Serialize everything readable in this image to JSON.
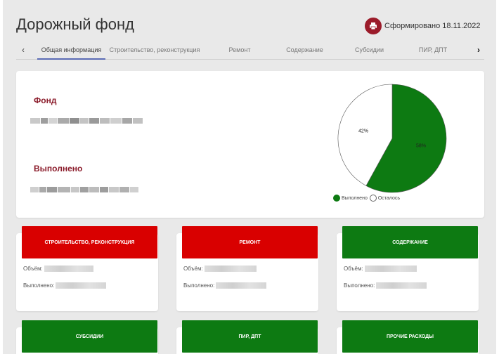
{
  "header": {
    "title": "Дорожный фонд",
    "report_text": "Сформировано 18.11.2022"
  },
  "tabs": [
    {
      "label": "Общая информация",
      "active": true
    },
    {
      "label": "Строительство, реконструкция",
      "active": false
    },
    {
      "label": "Ремонт",
      "active": false
    },
    {
      "label": "Содержание",
      "active": false
    },
    {
      "label": "Субсидии",
      "active": false
    },
    {
      "label": "ПИР, ДПТ",
      "active": false
    }
  ],
  "summary": {
    "fund_label": "Фонд",
    "done_label": "Выполнено"
  },
  "chart_data": {
    "type": "pie",
    "slices": [
      {
        "label": "Выполнено",
        "value": 58,
        "text": "58%",
        "color": "#0d7a12"
      },
      {
        "label": "Осталось",
        "value": 42,
        "text": "42%",
        "color": "#ffffff"
      }
    ],
    "legend": [
      "Выполнено",
      "Осталось"
    ],
    "legend_position": "bottom"
  },
  "categories": [
    {
      "title": "СТРОИТЕЛЬСТВО, РЕКОНСТРУКЦИЯ",
      "color": "#d90000",
      "volume_label": "Объём:",
      "done_label": "Выполнено:"
    },
    {
      "title": "РЕМОНТ",
      "color": "#d90000",
      "volume_label": "Объём:",
      "done_label": "Выполнено:"
    },
    {
      "title": "СОДЕРЖАНИЕ",
      "color": "#0d7a12",
      "volume_label": "Объём:",
      "done_label": "Выполнено:"
    },
    {
      "title": "СУБСИДИИ",
      "color": "#0d7a12"
    },
    {
      "title": "ПИР, ДПТ",
      "color": "#0d7a12"
    },
    {
      "title": "ПРОЧИЕ РАСХОДЫ",
      "color": "#0d7a12"
    }
  ],
  "colors": {
    "accent": "#8b1c2b",
    "done": "#0d7a12",
    "alert": "#d90000",
    "tab_indicator": "#5b6bb5"
  }
}
